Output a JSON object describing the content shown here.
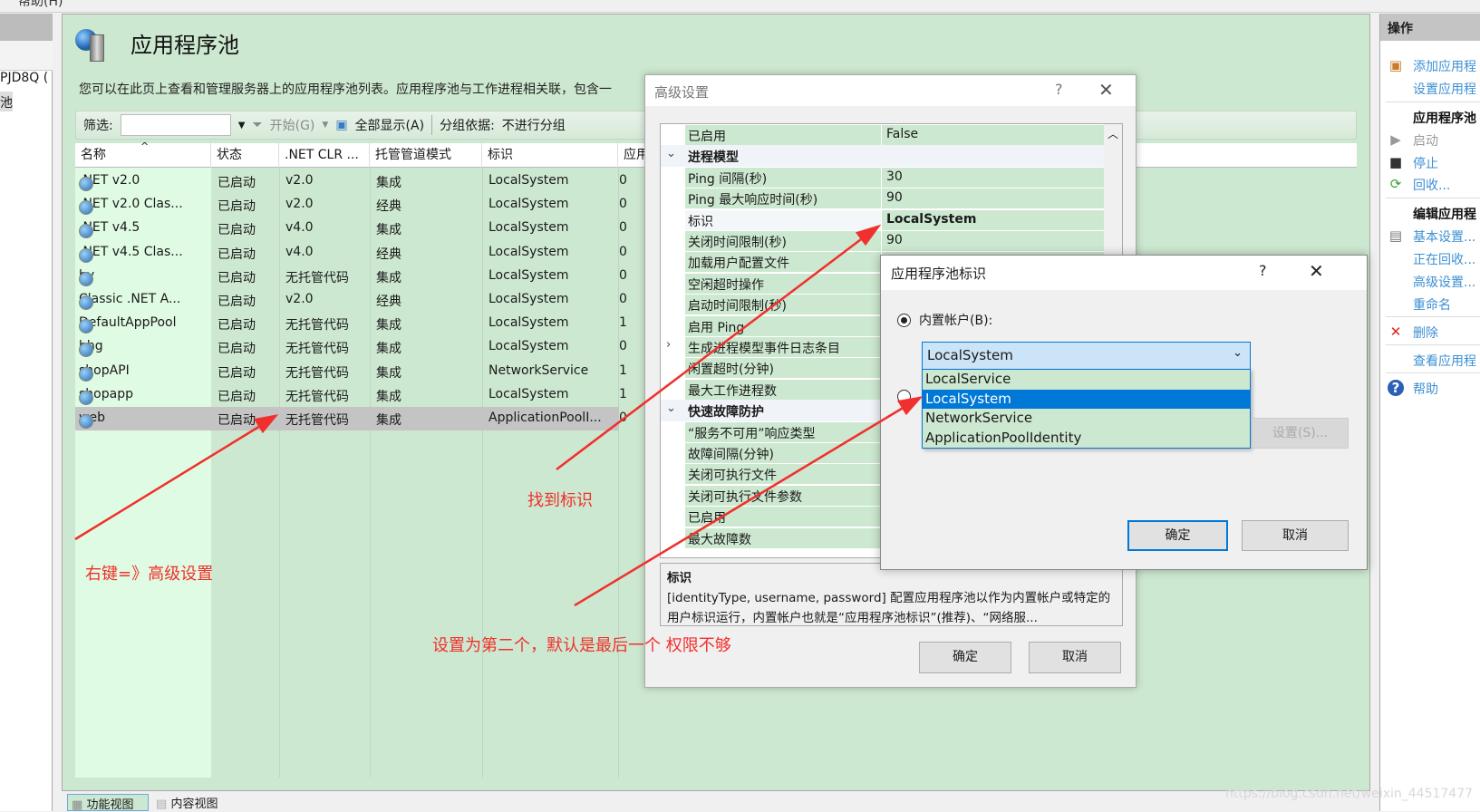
{
  "menubar": {
    "help": "帮助(H)"
  },
  "left_pane": {
    "server": "PJD8Q (",
    "node": "池"
  },
  "page": {
    "title": "应用程序池",
    "description": "您可以在此页上查看和管理服务器上的应用程序池列表。应用程序池与工作进程相关联，包含一",
    "filter_label": "筛选:",
    "filter_value": "",
    "start_label": "开始(G)",
    "show_all_label": "全部显示(A)",
    "group_label": "分组依据:",
    "group_value": "不进行分组"
  },
  "table": {
    "columns": [
      "名称",
      "状态",
      ".NET CLR ...",
      "托管管道模式",
      "标识",
      "应用"
    ],
    "rows": [
      {
        "name": ".NET v2.0",
        "status": "已启动",
        "clr": "v2.0",
        "pipeline": "集成",
        "identity": "LocalSystem",
        "apps": "0"
      },
      {
        "name": ".NET v2.0 Clas...",
        "status": "已启动",
        "clr": "v2.0",
        "pipeline": "经典",
        "identity": "LocalSystem",
        "apps": "0"
      },
      {
        "name": ".NET v4.5",
        "status": "已启动",
        "clr": "v4.0",
        "pipeline": "集成",
        "identity": "LocalSystem",
        "apps": "0"
      },
      {
        "name": ".NET v4.5 Clas...",
        "status": "已启动",
        "clr": "v4.0",
        "pipeline": "经典",
        "identity": "LocalSystem",
        "apps": "0"
      },
      {
        "name": "by",
        "status": "已启动",
        "clr": "无托管代码",
        "pipeline": "集成",
        "identity": "LocalSystem",
        "apps": "0"
      },
      {
        "name": "Classic .NET A...",
        "status": "已启动",
        "clr": "v2.0",
        "pipeline": "经典",
        "identity": "LocalSystem",
        "apps": "0"
      },
      {
        "name": "DefaultAppPool",
        "status": "已启动",
        "clr": "无托管代码",
        "pipeline": "集成",
        "identity": "LocalSystem",
        "apps": "1"
      },
      {
        "name": "hhg",
        "status": "已启动",
        "clr": "无托管代码",
        "pipeline": "集成",
        "identity": "LocalSystem",
        "apps": "0"
      },
      {
        "name": "shopAPI",
        "status": "已启动",
        "clr": "无托管代码",
        "pipeline": "集成",
        "identity": "NetworkService",
        "apps": "1"
      },
      {
        "name": "shopapp",
        "status": "已启动",
        "clr": "无托管代码",
        "pipeline": "集成",
        "identity": "LocalSystem",
        "apps": "1"
      },
      {
        "name": "web",
        "status": "已启动",
        "clr": "无托管代码",
        "pipeline": "集成",
        "identity": "ApplicationPoolI...",
        "apps": "0",
        "selected": true
      }
    ]
  },
  "bottom_tabs": [
    "功能视图",
    "内容视图"
  ],
  "actions": {
    "header": "操作",
    "items": [
      {
        "label": "添加应用程",
        "type": "link",
        "icon": "add-pool-icon"
      },
      {
        "label": "设置应用程",
        "type": "link"
      },
      {
        "label": "应用程序池",
        "type": "heading"
      },
      {
        "label": "启动",
        "type": "disabled",
        "icon": "play-icon"
      },
      {
        "label": "停止",
        "type": "link",
        "icon": "stop-icon"
      },
      {
        "label": "回收...",
        "type": "link",
        "icon": "recycle-icon"
      },
      {
        "label": "编辑应用程",
        "type": "heading"
      },
      {
        "label": "基本设置...",
        "type": "link",
        "icon": "settings-icon"
      },
      {
        "label": "正在回收...",
        "type": "link"
      },
      {
        "label": "高级设置...",
        "type": "link"
      },
      {
        "label": "重命名",
        "type": "link"
      },
      {
        "label": "删除",
        "type": "link",
        "icon": "delete-icon"
      },
      {
        "label": "查看应用程",
        "type": "link"
      },
      {
        "label": "帮助",
        "type": "link",
        "icon": "help-icon"
      }
    ]
  },
  "advanced_dialog": {
    "title": "高级设置",
    "help": "?",
    "close": "✕",
    "rows": [
      {
        "key": "已启用",
        "value": "False"
      },
      {
        "key": "进程模型",
        "category": true,
        "toggle": "⌄"
      },
      {
        "key": "Ping 间隔(秒)",
        "value": "30"
      },
      {
        "key": "Ping 最大响应时间(秒)",
        "value": "90"
      },
      {
        "key": "标识",
        "value": "LocalSystem",
        "bold": true
      },
      {
        "key": "关闭时间限制(秒)",
        "value": "90"
      },
      {
        "key": "加载用户配置文件",
        "value": ""
      },
      {
        "key": "空闲超时操作",
        "value": ""
      },
      {
        "key": "启动时间限制(秒)",
        "value": ""
      },
      {
        "key": "启用 Ping",
        "value": ""
      },
      {
        "key": "生成进程模型事件日志条目",
        "value": "",
        "toggle": "›"
      },
      {
        "key": "闲置超时(分钟)",
        "value": ""
      },
      {
        "key": "最大工作进程数",
        "value": ""
      },
      {
        "key": "快速故障防护",
        "category": true,
        "toggle": "⌄"
      },
      {
        "key": "“服务不可用”响应类型",
        "value": ""
      },
      {
        "key": "故障间隔(分钟)",
        "value": ""
      },
      {
        "key": "关闭可执行文件",
        "value": ""
      },
      {
        "key": "关闭可执行文件参数",
        "value": ""
      },
      {
        "key": "已启用",
        "value": ""
      },
      {
        "key": "最大故障数",
        "value": ""
      }
    ],
    "desc_title": "标识",
    "desc_text": "[identityType, username, password] 配置应用程序池以作为内置帐户或特定的用户标识运行，内置帐户也就是“应用程序池标识”(推荐)、“网络服...",
    "ok": "确定",
    "cancel": "取消"
  },
  "identity_dialog": {
    "title": "应用程序池标识",
    "help": "?",
    "close": "✕",
    "builtin_label": "内置帐户(B):",
    "builtin_selected": true,
    "combo_value": "LocalSystem",
    "options": [
      "LocalService",
      "LocalSystem",
      "NetworkService",
      "ApplicationPoolIdentity"
    ],
    "highlighted_option": "LocalSystem",
    "custom_selected": false,
    "set_button": "设置(S)...",
    "ok": "确定",
    "cancel": "取消"
  },
  "annotations": {
    "right_click": "右键=》高级设置",
    "find_identity": "找到标识",
    "set_second": "设置为第二个，默认是最后一个 权限不够",
    "color": "#f0302c"
  },
  "watermark": "https://blog.csdn.net/weixin_44517477"
}
